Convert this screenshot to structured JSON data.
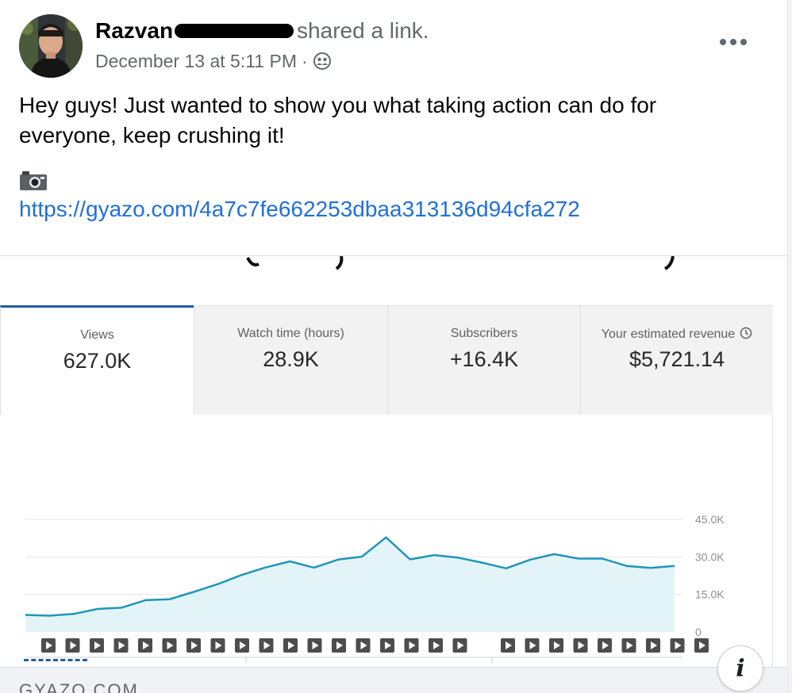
{
  "post": {
    "author_name": "Razvan",
    "action_text": "shared a link.",
    "timestamp": "December 13 at 5:11 PM",
    "meta_separator": "·",
    "audience_icon": "friends-icon",
    "more_icon": "more-options-icon",
    "text": "Hey guys! Just wanted to show you what taking action can do for everyone, keep crushing it!",
    "emoji_icon": "camera-icon",
    "link": "https://gyazo.com/4a7c7fe662253dbaa313136d94cfa272"
  },
  "analytics": {
    "tabs": [
      {
        "label": "Views",
        "value": "627.0K"
      },
      {
        "label": "Watch time (hours)",
        "value": "28.9K"
      },
      {
        "label": "Subscribers",
        "value": "+16.4K"
      },
      {
        "label": "Your estimated revenue",
        "value": "$5,721.14"
      }
    ],
    "clock_icon": "clock-icon"
  },
  "footer": {
    "site": "GYAZO.COM",
    "info_label": "i"
  },
  "colors": {
    "link": "#216fdb",
    "line": "#2196b6",
    "area": "#e3f4f9",
    "active_tab": "#1f5f9f"
  },
  "chart_data": {
    "type": "area",
    "y_ticks": [
      "45.0K",
      "30.0K",
      "15.0K",
      "0"
    ],
    "ylim": [
      0,
      45000
    ],
    "values": [
      6800,
      6500,
      7200,
      9200,
      9700,
      12700,
      13100,
      16000,
      19100,
      22800,
      25800,
      28200,
      25700,
      28900,
      30100,
      37800,
      29000,
      30700,
      29700,
      27700,
      25400,
      28900,
      31100,
      29300,
      29300,
      26400,
      25600,
      26400
    ],
    "video_markers": 27,
    "grid": true
  }
}
